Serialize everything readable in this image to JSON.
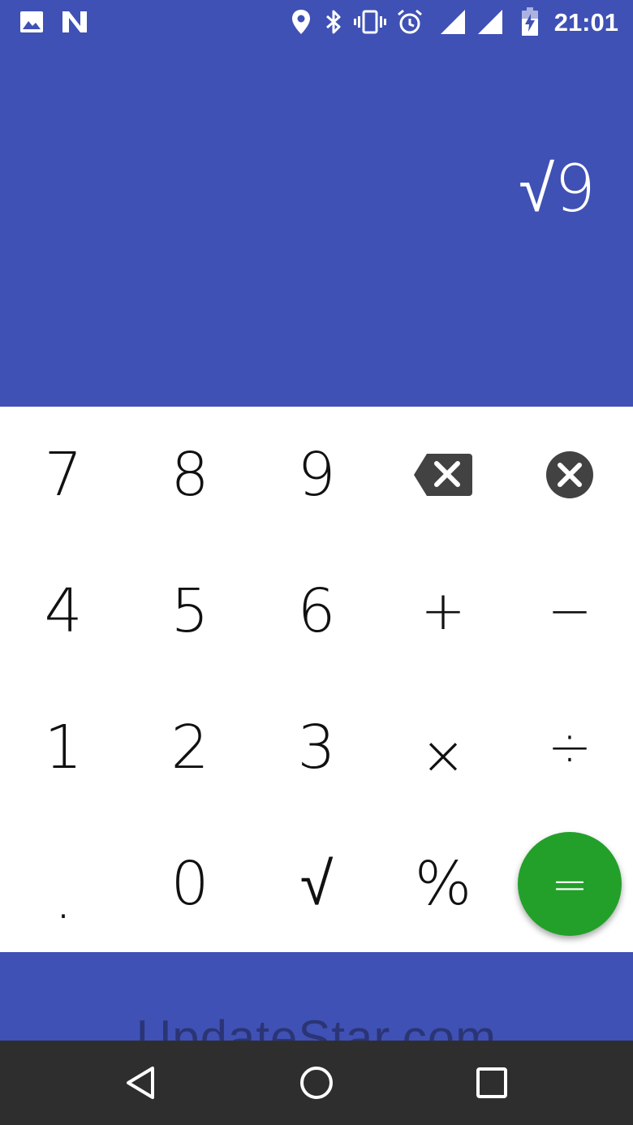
{
  "colors": {
    "primary": "#3f51b5",
    "keypad_bg": "#ffffff",
    "equals_fab": "#23a02a",
    "nav_bar": "#2e2e2e",
    "delete_icon": "#424242"
  },
  "status_bar": {
    "time": "21:01",
    "icons": [
      "image-icon",
      "n-notification-icon",
      "location-icon",
      "bluetooth-icon",
      "vibrate-icon",
      "alarm-icon",
      "signal-icon",
      "signal-icon",
      "battery-charging-icon"
    ]
  },
  "display": {
    "expression": "√9"
  },
  "keypad": {
    "rows": [
      [
        "7",
        "8",
        "9",
        "backspace",
        "clear"
      ],
      [
        "4",
        "5",
        "6",
        "+",
        "−"
      ],
      [
        "1",
        "2",
        "3",
        "×",
        "÷"
      ],
      [
        ".",
        "0",
        "√",
        "%",
        "="
      ]
    ],
    "keys": {
      "k7": "7",
      "k8": "8",
      "k9": "9",
      "k4": "4",
      "k5": "5",
      "k6": "6",
      "k1": "1",
      "k2": "2",
      "k3": "3",
      "kdot": ".",
      "k0": "0",
      "ksqrt": "√",
      "kpercent": "%",
      "kplus": "+",
      "kminus": "−",
      "ktimes": "×",
      "kdivide": "÷",
      "kequals": "="
    }
  },
  "watermark": "UpdateStar.com",
  "nav": {
    "icons": [
      "back-icon",
      "home-icon",
      "recents-icon"
    ]
  }
}
